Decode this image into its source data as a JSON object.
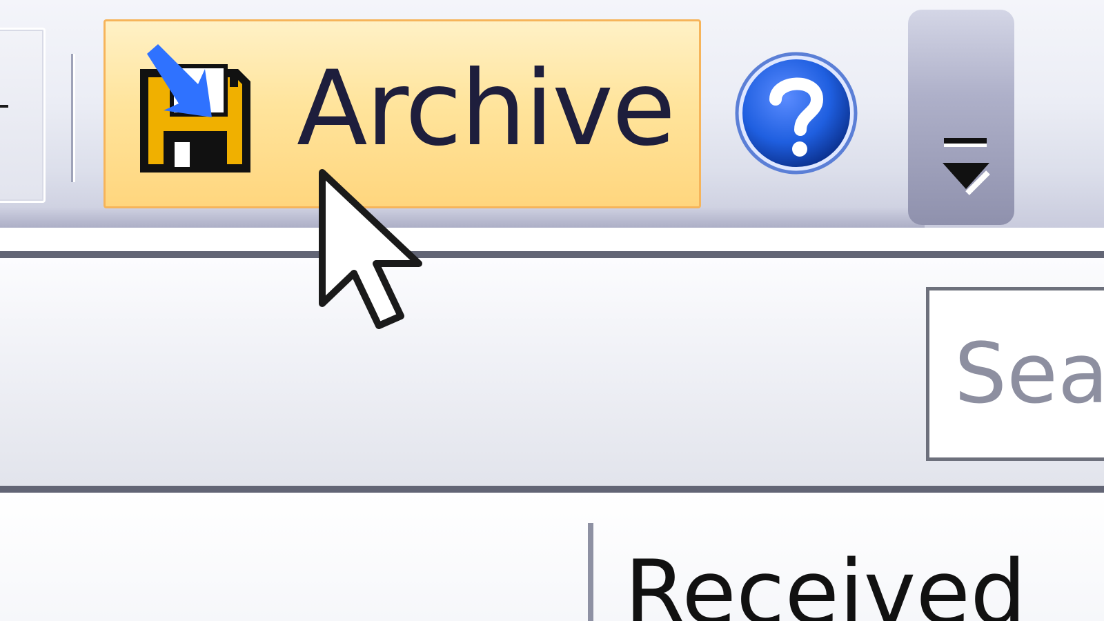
{
  "toolbar": {
    "archive_label": "Archive",
    "archive_icon": "floppy-disk-save-icon",
    "help_icon": "help-question-icon",
    "overflow_icon": "toolbar-overflow-chevron-icon"
  },
  "search": {
    "placeholder": "Sea"
  },
  "list": {
    "columns": [
      "Received"
    ]
  },
  "colors": {
    "hover_border": "#f6b45a",
    "hover_fill": "#ffe49c",
    "help_blue": "#1f5fe0",
    "floppy_body": "#f0b000",
    "arrow_blue": "#2f72ff"
  }
}
